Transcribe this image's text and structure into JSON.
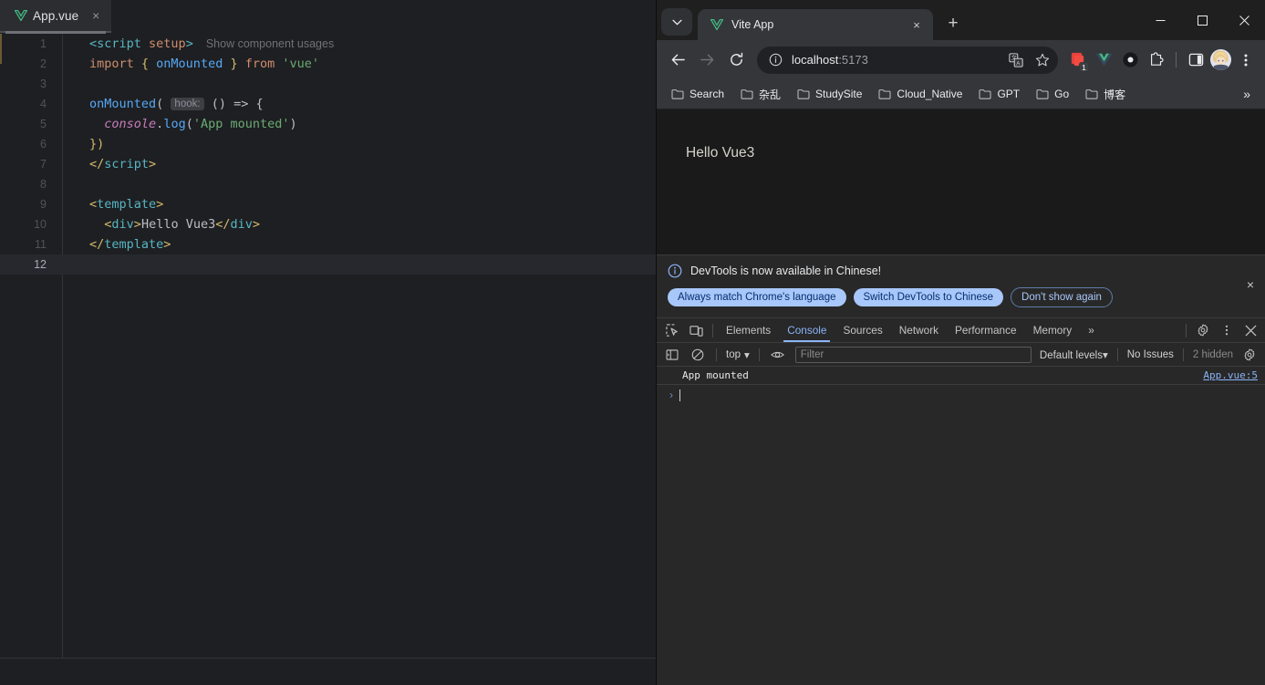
{
  "ide": {
    "tab": {
      "label": "App.vue",
      "icon": "vue-logo-icon",
      "close_icon": "×"
    },
    "inlay_hint": "Show component usages",
    "lines": [
      {
        "n": "1"
      },
      {
        "n": "2"
      },
      {
        "n": "3"
      },
      {
        "n": "4"
      },
      {
        "n": "5"
      },
      {
        "n": "6"
      },
      {
        "n": "7"
      },
      {
        "n": "8"
      },
      {
        "n": "9"
      },
      {
        "n": "10"
      },
      {
        "n": "11"
      },
      {
        "n": "12"
      }
    ],
    "code": {
      "l1_a": "<script",
      "l1_b": " setup",
      "l1_c": ">",
      "l2_import": "import",
      "l2_brace_open": " { ",
      "l2_onmounted": "onMounted",
      "l2_brace_close": " } ",
      "l2_from": "from",
      "l2_str": " 'vue'",
      "l4_fn": "onMounted",
      "l4_paren": "( ",
      "l4_inlay": "hook:",
      "l4_rest": " () => {",
      "l5_console": "console",
      "l5_dot": ".",
      "l5_log": "log",
      "l5_open": "(",
      "l5_str": "'App mounted'",
      "l5_close": ")",
      "l6": "})",
      "l7_a": "</",
      "l7_b": "script",
      "l7_c": ">",
      "l9_a": "<",
      "l9_b": "template",
      "l9_c": ">",
      "l10_a": "<",
      "l10_b": "div",
      "l10_c": ">",
      "l10_text": "Hello Vue3",
      "l10_d": "</",
      "l10_e": "div",
      "l10_f": ">",
      "l11_a": "</",
      "l11_b": "template",
      "l11_c": ">"
    }
  },
  "chrome": {
    "tab_search_icon": "chevron-down-icon",
    "tab": {
      "title": "Vite App",
      "favicon": "vue-logo-icon",
      "close_icon": "×"
    },
    "new_tab_label": "+",
    "window_controls": {
      "minimize": "—",
      "maximize": "□",
      "close": "×"
    },
    "toolbar": {
      "back_icon": "arrow-left-icon",
      "forward_icon": "arrow-right-icon",
      "reload_icon": "reload-icon",
      "site_info_icon": "info-circle-icon",
      "url_host": "localhost",
      "url_port": ":5173",
      "translate_icon": "translate-icon",
      "bookmark_icon": "star-icon",
      "extensions": [
        {
          "name": "clipboard-extension-icon",
          "badge": "1"
        },
        {
          "name": "vue-devtools-extension-icon",
          "badge": ""
        },
        {
          "name": "circle-extension-icon",
          "badge": ""
        },
        {
          "name": "puzzle-extensions-icon",
          "badge": ""
        }
      ],
      "side_panel_icon": "side-panel-icon",
      "avatar_icon": "user-avatar",
      "menu_icon": "three-dots-vertical-icon"
    },
    "bookmarks": [
      {
        "label": "Search"
      },
      {
        "label": "杂乱"
      },
      {
        "label": "StudySite"
      },
      {
        "label": "Cloud_Native"
      },
      {
        "label": "GPT"
      },
      {
        "label": "Go"
      },
      {
        "label": "博客"
      }
    ],
    "bookmarks_overflow": "»",
    "page": {
      "hello_text": "Hello Vue3"
    }
  },
  "devtools": {
    "banner": {
      "icon": "info-circle-icon",
      "text": "DevTools is now available in Chinese!",
      "buttons": [
        {
          "label": "Always match Chrome's language",
          "style": "filled"
        },
        {
          "label": "Switch DevTools to Chinese",
          "style": "filled"
        },
        {
          "label": "Don't show again",
          "style": "outline"
        }
      ],
      "close_icon": "×"
    },
    "tabs": [
      {
        "label": "Elements",
        "active": false
      },
      {
        "label": "Console",
        "active": true
      },
      {
        "label": "Sources",
        "active": false
      },
      {
        "label": "Network",
        "active": false
      },
      {
        "label": "Performance",
        "active": false
      },
      {
        "label": "Memory",
        "active": false
      }
    ],
    "tabs_overflow": "»",
    "inspect_icon": "inspect-element-icon",
    "device_icon": "device-toolbar-icon",
    "settings_icon": "gear-icon",
    "more_icon": "three-dots-vertical-icon",
    "close_icon": "×",
    "console_toolbar": {
      "sidebar_icon": "console-sidebar-icon",
      "clear_icon": "clear-console-icon",
      "context": "top",
      "context_caret": "▾",
      "eye_icon": "live-expression-icon",
      "filter_placeholder": "Filter",
      "levels_label": "Default levels",
      "levels_caret": "▾",
      "issues_label": "No Issues",
      "hidden_label": "2 hidden",
      "settings_icon": "gear-icon"
    },
    "console_messages": [
      {
        "text": "App mounted",
        "source": "App.vue:5"
      }
    ],
    "prompt_caret": "›"
  },
  "colors": {
    "vue_green": "#42b883",
    "accent_blue": "#8ab4f8",
    "pill_bg": "#a8c7fa",
    "ide_bg": "#1e1f22",
    "chrome_toolbar": "#35363a",
    "devtools_bg": "#282828"
  }
}
